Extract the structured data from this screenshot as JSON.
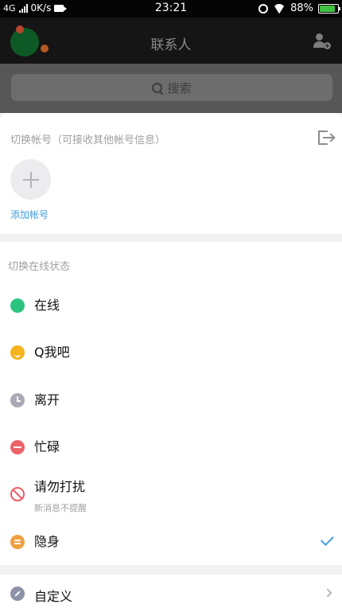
{
  "status_bar": {
    "network": "4G",
    "speed": "0K/s",
    "time": "23:21",
    "battery": "88%",
    "battery_level": 0.88
  },
  "header": {
    "title": "联系人"
  },
  "search": {
    "placeholder": "搜索"
  },
  "account_switch": {
    "title": "切换帐号（可接收其他帐号信息）",
    "add_label": "添加帐号"
  },
  "online_status": {
    "title": "切换在线状态",
    "items": [
      {
        "label": "在线",
        "icon": "online-dot-icon",
        "color": "#2cc37f"
      },
      {
        "label": "Q我吧",
        "icon": "smile-icon",
        "color": "#f6b31c"
      },
      {
        "label": "离开",
        "icon": "clock-icon",
        "color": "#a9aab5"
      },
      {
        "label": "忙碌",
        "icon": "busy-icon",
        "color": "#ec6269"
      },
      {
        "label": "请勿打扰",
        "sub": "新消息不提醒",
        "icon": "no-disturb-icon",
        "color": "#ec5a63"
      },
      {
        "label": "隐身",
        "icon": "invisible-icon",
        "color": "#f0a040",
        "selected": true
      }
    ]
  },
  "custom": {
    "label": "自定义"
  },
  "colors": {
    "accent": "#3f9fe0"
  }
}
